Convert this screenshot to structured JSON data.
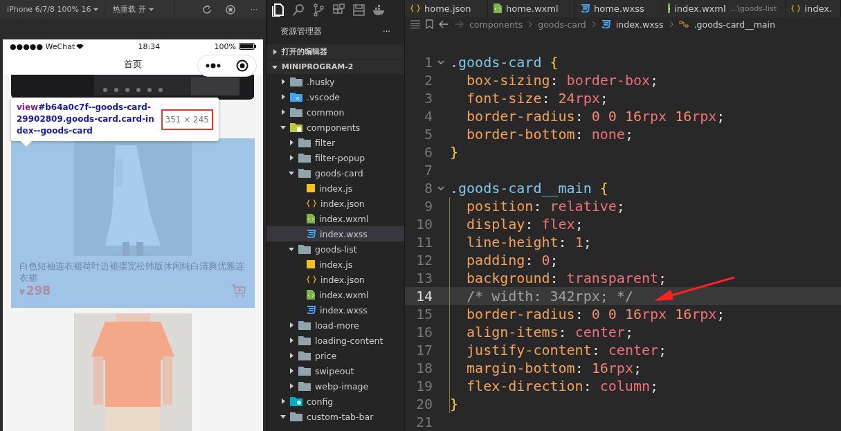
{
  "simulator": {
    "device": "iPhone 6/7/8 100% 16",
    "hot_reload": "热重载 开",
    "more": "···",
    "phone": {
      "carrier": "●●●●● WeChat",
      "time": "18:34",
      "battery": "100%",
      "title": "首页",
      "inspector": {
        "tag": "view",
        "selector": "#b64a0c7f--goods-card-29902809.goods-card.card-index--goods-card",
        "size": "351 × 245"
      },
      "cards": [
        {
          "name": "白色短袖连衣裙荷叶边裙摆宽松韩版休闲纯白清爽优雅连衣裙",
          "currency": "¥",
          "price": "298",
          "highlighted": true
        },
        {
          "highlighted": false
        }
      ]
    }
  },
  "explorer": {
    "title": "资源管理器",
    "more": "···",
    "activity": [
      {
        "kind": "files",
        "selected": true
      },
      {
        "kind": "search",
        "selected": false
      },
      {
        "kind": "git",
        "selected": false
      },
      {
        "kind": "extensions",
        "selected": false
      },
      {
        "kind": "save",
        "selected": false
      },
      {
        "kind": "docker",
        "selected": false
      }
    ],
    "sections": [
      {
        "label": "打开的编辑器",
        "expanded": false
      },
      {
        "label": "MINIPROGRAM-2",
        "expanded": true
      }
    ],
    "tree": [
      {
        "label": ".husky",
        "kind": "folder",
        "expanded": false
      },
      {
        "label": ".vscode",
        "kind": "vscode",
        "expanded": false
      },
      {
        "label": "common",
        "kind": "folder",
        "expanded": false
      },
      {
        "label": "components",
        "kind": "components",
        "expanded": true,
        "children": [
          {
            "label": "filter",
            "kind": "folder",
            "expanded": false
          },
          {
            "label": "filter-popup",
            "kind": "folder",
            "expanded": false
          },
          {
            "label": "goods-card",
            "kind": "folder",
            "expanded": true,
            "children": [
              {
                "label": "index.js",
                "kind": "js",
                "selected": false
              },
              {
                "label": "index.json",
                "kind": "json",
                "selected": false
              },
              {
                "label": "index.wxml",
                "kind": "wxml",
                "selected": false
              },
              {
                "label": "index.wxss",
                "kind": "wxss",
                "selected": true
              }
            ]
          },
          {
            "label": "goods-list",
            "kind": "folder",
            "expanded": true,
            "children": [
              {
                "label": "index.js",
                "kind": "js",
                "selected": false
              },
              {
                "label": "index.json",
                "kind": "json",
                "selected": false
              },
              {
                "label": "index.wxml",
                "kind": "wxml",
                "selected": false
              },
              {
                "label": "index.wxss",
                "kind": "wxss",
                "selected": false
              }
            ]
          },
          {
            "label": "load-more",
            "kind": "folder",
            "expanded": false
          },
          {
            "label": "loading-content",
            "kind": "folder",
            "expanded": false
          },
          {
            "label": "price",
            "kind": "folder",
            "expanded": false
          },
          {
            "label": "swipeout",
            "kind": "folder",
            "expanded": false
          },
          {
            "label": "webp-image",
            "kind": "folder",
            "expanded": false
          }
        ]
      },
      {
        "label": "config",
        "kind": "config",
        "expanded": false
      },
      {
        "label": "custom-tab-bar",
        "kind": "folder",
        "expanded": true
      }
    ]
  },
  "editor": {
    "tabs": [
      {
        "label": "home.json",
        "kind": "json"
      },
      {
        "label": "home.wxml",
        "kind": "wxml"
      },
      {
        "label": "home.wxss",
        "kind": "wxss"
      },
      {
        "label": "index.wxml",
        "kind": "wxml",
        "hint": "...\\goods-list"
      },
      {
        "label": "index.",
        "kind": "json"
      }
    ],
    "breadcrumb": [
      "components",
      "goods-card",
      "index.wxss",
      ".goods-card__main"
    ],
    "lines": [
      {
        "number": "1",
        "fold": true,
        "current": false,
        "indented": false,
        "tokens": [
          {
            "kind": "selector",
            "text": ".goods-card"
          },
          {
            "kind": "brace",
            "text": " {"
          }
        ]
      },
      {
        "number": "2",
        "current": false,
        "indented": true,
        "tokens": [
          {
            "kind": "prop",
            "text": "box-sizing"
          },
          {
            "kind": "plain",
            "text": ": "
          },
          {
            "kind": "value",
            "text": "border-box"
          },
          {
            "kind": "plain",
            "text": ";"
          }
        ]
      },
      {
        "number": "3",
        "current": false,
        "indented": true,
        "tokens": [
          {
            "kind": "prop",
            "text": "font-size"
          },
          {
            "kind": "plain",
            "text": ": "
          },
          {
            "kind": "num",
            "text": "24"
          },
          {
            "kind": "value",
            "text": "rpx"
          },
          {
            "kind": "plain",
            "text": ";"
          }
        ]
      },
      {
        "number": "4",
        "current": false,
        "indented": true,
        "tokens": [
          {
            "kind": "prop",
            "text": "border-radius"
          },
          {
            "kind": "plain",
            "text": ": "
          },
          {
            "kind": "num",
            "text": "0 0 16"
          },
          {
            "kind": "value",
            "text": "rpx"
          },
          {
            "kind": "num",
            "text": " 16"
          },
          {
            "kind": "value",
            "text": "rpx"
          },
          {
            "kind": "plain",
            "text": ";"
          }
        ]
      },
      {
        "number": "5",
        "current": false,
        "indented": true,
        "tokens": [
          {
            "kind": "prop",
            "text": "border-bottom"
          },
          {
            "kind": "plain",
            "text": ": "
          },
          {
            "kind": "value",
            "text": "none"
          },
          {
            "kind": "plain",
            "text": ";"
          }
        ]
      },
      {
        "number": "6",
        "current": false,
        "indented": false,
        "tokens": [
          {
            "kind": "brace",
            "text": "}"
          }
        ]
      },
      {
        "number": "7",
        "current": false
      },
      {
        "number": "8",
        "fold": true,
        "current": false,
        "indented": false,
        "tokens": [
          {
            "kind": "selector",
            "text": ".goods-card__main"
          },
          {
            "kind": "brace",
            "text": " {"
          }
        ]
      },
      {
        "number": "9",
        "current": false,
        "indented": true,
        "tokens": [
          {
            "kind": "prop",
            "text": "position"
          },
          {
            "kind": "plain",
            "text": ": "
          },
          {
            "kind": "value",
            "text": "relative"
          },
          {
            "kind": "plain",
            "text": ";"
          }
        ]
      },
      {
        "number": "10",
        "current": false,
        "indented": true,
        "tokens": [
          {
            "kind": "prop",
            "text": "display"
          },
          {
            "kind": "plain",
            "text": ": "
          },
          {
            "kind": "value",
            "text": "flex"
          },
          {
            "kind": "plain",
            "text": ";"
          }
        ]
      },
      {
        "number": "11",
        "current": false,
        "indented": true,
        "tokens": [
          {
            "kind": "prop",
            "text": "line-height"
          },
          {
            "kind": "plain",
            "text": ": "
          },
          {
            "kind": "num",
            "text": "1"
          },
          {
            "kind": "plain",
            "text": ";"
          }
        ]
      },
      {
        "number": "12",
        "current": false,
        "indented": true,
        "tokens": [
          {
            "kind": "prop",
            "text": "padding"
          },
          {
            "kind": "plain",
            "text": ": "
          },
          {
            "kind": "num",
            "text": "0"
          },
          {
            "kind": "plain",
            "text": ";"
          }
        ]
      },
      {
        "number": "13",
        "current": false,
        "indented": true,
        "tokens": [
          {
            "kind": "prop",
            "text": "background"
          },
          {
            "kind": "plain",
            "text": ": "
          },
          {
            "kind": "value",
            "text": "transparent"
          },
          {
            "kind": "plain",
            "text": ";"
          }
        ]
      },
      {
        "number": "14",
        "current": true,
        "indented": true,
        "tokens": [
          {
            "kind": "comment",
            "text": "/* width: 342rpx; */"
          }
        ]
      },
      {
        "number": "15",
        "current": false,
        "indented": true,
        "tokens": [
          {
            "kind": "prop",
            "text": "border-radius"
          },
          {
            "kind": "plain",
            "text": ": "
          },
          {
            "kind": "num",
            "text": "0 0 16"
          },
          {
            "kind": "value",
            "text": "rpx"
          },
          {
            "kind": "num",
            "text": " 16"
          },
          {
            "kind": "value",
            "text": "rpx"
          },
          {
            "kind": "plain",
            "text": ";"
          }
        ]
      },
      {
        "number": "16",
        "current": false,
        "indented": true,
        "tokens": [
          {
            "kind": "prop",
            "text": "align-items"
          },
          {
            "kind": "plain",
            "text": ": "
          },
          {
            "kind": "value",
            "text": "center"
          },
          {
            "kind": "plain",
            "text": ";"
          }
        ]
      },
      {
        "number": "17",
        "current": false,
        "indented": true,
        "tokens": [
          {
            "kind": "prop",
            "text": "justify-content"
          },
          {
            "kind": "plain",
            "text": ": "
          },
          {
            "kind": "value",
            "text": "center"
          },
          {
            "kind": "plain",
            "text": ";"
          }
        ]
      },
      {
        "number": "18",
        "current": false,
        "indented": true,
        "tokens": [
          {
            "kind": "prop",
            "text": "margin-bottom"
          },
          {
            "kind": "plain",
            "text": ": "
          },
          {
            "kind": "num",
            "text": "16"
          },
          {
            "kind": "value",
            "text": "rpx"
          },
          {
            "kind": "plain",
            "text": ";"
          }
        ]
      },
      {
        "number": "19",
        "current": false,
        "indented": true,
        "tokens": [
          {
            "kind": "prop",
            "text": "flex-direction"
          },
          {
            "kind": "plain",
            "text": ": "
          },
          {
            "kind": "value",
            "text": "column"
          },
          {
            "kind": "plain",
            "text": ";"
          }
        ]
      },
      {
        "number": "20",
        "current": false,
        "indented": false,
        "tokens": [
          {
            "kind": "brace",
            "text": "}"
          }
        ]
      },
      {
        "number": "21",
        "current": false
      }
    ]
  }
}
